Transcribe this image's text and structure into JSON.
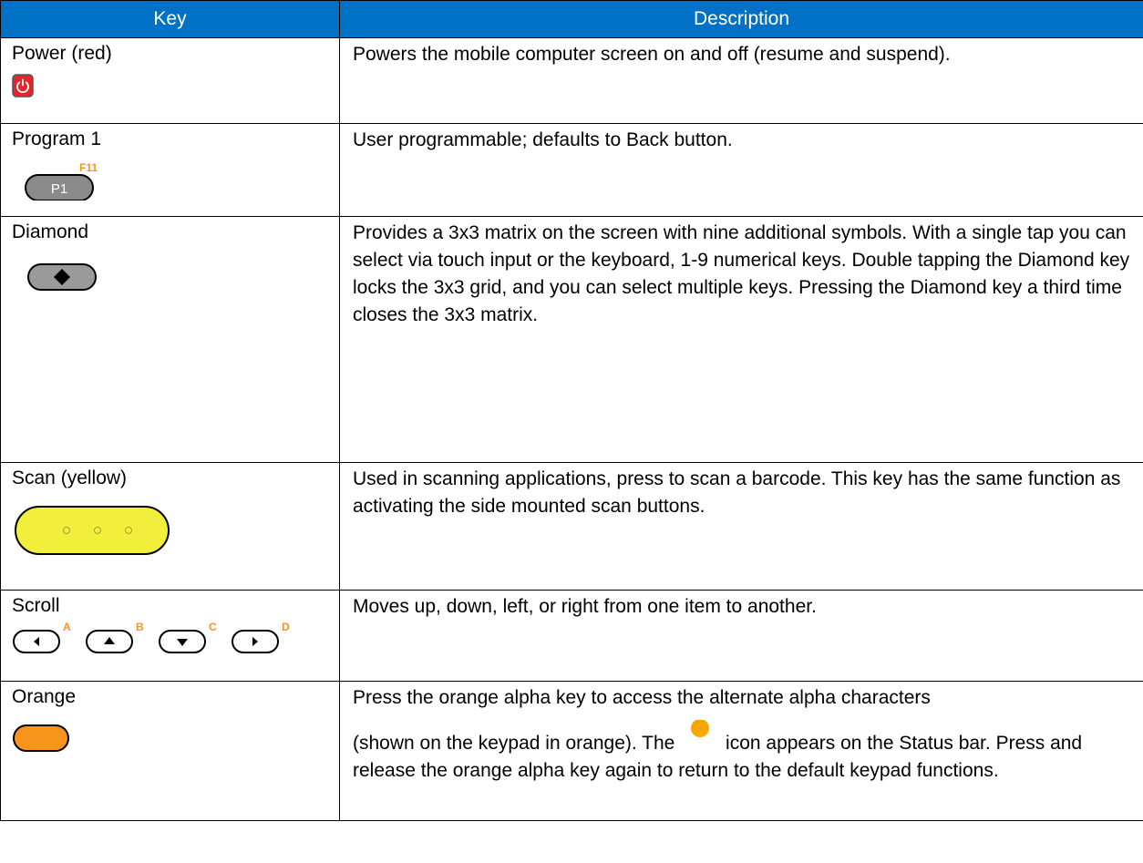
{
  "table": {
    "headers": {
      "key": "Key",
      "description": "Description"
    },
    "rows": [
      {
        "key": "Power (red)",
        "icon": "power-key-icon",
        "description": "Powers the mobile computer screen on and off (resume and suspend)."
      },
      {
        "key": "Program 1",
        "icon": "program-1-key-icon",
        "key_label": "P1",
        "superscript": "F11",
        "description": "User programmable; defaults to Back button."
      },
      {
        "key": "Diamond",
        "icon": "diamond-key-icon",
        "description": "Provides a 3x3 matrix on the screen with nine additional symbols. With a single tap you can select via touch input or the keyboard, 1-9 numerical keys. Double tapping the Diamond key locks the 3x3 grid, and you can select multiple keys. Pressing the Diamond key a third time closes the 3x3 matrix."
      },
      {
        "key": "Scan (yellow)",
        "icon": "scan-key-icon",
        "description": "Used in scanning applications, press to scan a barcode. This key has the same function as activating the side mounted scan buttons."
      },
      {
        "key": "Scroll",
        "icon": "scroll-keys-icon",
        "scroll_labels": [
          "A",
          "B",
          "C",
          "D"
        ],
        "description": "Moves up, down, left, or right from one item to another."
      },
      {
        "key": "Orange",
        "icon": "orange-key-icon",
        "description_part1": "Press the orange alpha key to access the alternate alpha characters",
        "description_part2": "(shown on the keypad in orange). The",
        "description_part3": "icon appears on the Status bar. Press and release the orange alpha key again to return to the default keypad functions."
      }
    ]
  },
  "colors": {
    "header_bg": "#0071c5",
    "orange": "#f7941d",
    "yellow": "#f1ef3b",
    "power_red": "#e3262c",
    "superscript_orange": "#f7941d"
  }
}
